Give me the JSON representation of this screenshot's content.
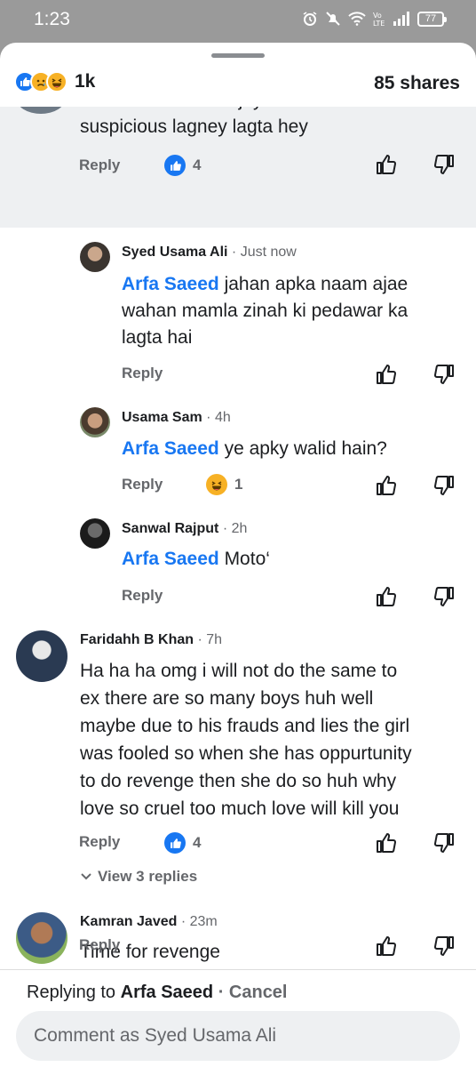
{
  "status_bar": {
    "time": "1:23",
    "battery": "77"
  },
  "post_bar": {
    "reaction_count": "1k",
    "shares": "85 shares"
  },
  "comments": [
    {
      "author": "",
      "time": "",
      "text_partial_top": "Janan inka naam Ajay mamla",
      "text": "suspicious lagney lagta hey",
      "reply_label": "Reply",
      "reaction_count": "4"
    },
    {
      "author": "Syed Usama Ali",
      "time": "· Just now",
      "mention": "Arfa Saeed",
      "text_line1": "jahan apka naam ajae",
      "text_line2": "wahan mamla zinah ki pedawar ka",
      "text_line3": "lagta hai",
      "reply_label": "Reply"
    },
    {
      "author": "Usama Sam",
      "time": "· 4h",
      "mention": "Arfa Saeed",
      "text": "ye apky walid hain?",
      "reply_label": "Reply",
      "reaction_count": "1"
    },
    {
      "author": "Sanwal Rajput",
      "time": "· 2h",
      "mention": "Arfa Saeed",
      "text": "Moto‘",
      "reply_label": "Reply"
    },
    {
      "author": "Faridahh B Khan",
      "time": "· 7h",
      "lines": [
        "Ha ha ha omg i will not do the same to",
        "ex there are so many boys huh well",
        "maybe due to his frauds and lies the girl",
        "was fooled so when she has oppurtunity",
        "to do revenge then she do so huh why",
        "love so cruel too much love will kill you"
      ],
      "reply_label": "Reply",
      "reaction_count": "4",
      "view_replies": "View 3 replies"
    },
    {
      "author": "Kamran Javed",
      "time": "· 23m",
      "text": "Time for revenge",
      "reply_label": "Reply"
    }
  ],
  "footer": {
    "replying_prefix": "Replying to",
    "replying_name": "Arfa Saeed",
    "cancel": "· Cancel",
    "placeholder": "Comment as Syed Usama Ali"
  }
}
